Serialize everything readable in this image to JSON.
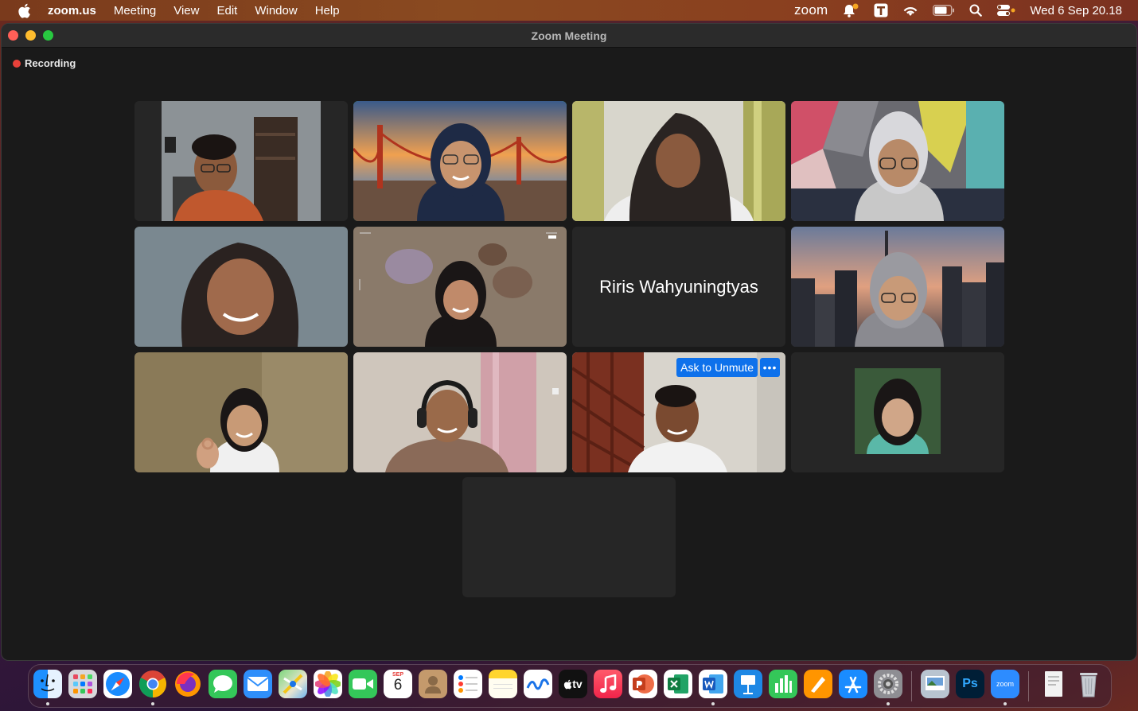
{
  "menubar": {
    "app_name": "zoom.us",
    "menus": [
      "Meeting",
      "View",
      "Edit",
      "Window",
      "Help"
    ],
    "status": {
      "zoom_label": "zoom",
      "clock": "Wed 6 Sep  20.18"
    }
  },
  "window": {
    "title": "Zoom Meeting",
    "recording_label": "Recording"
  },
  "gallery": {
    "name_card": "Riris Wahyuningtyas",
    "ask_unmute_label": "Ask to Unmute",
    "more_label": "•••"
  },
  "dock": {
    "calendar_month": "SEP",
    "calendar_day": "6",
    "tv_label": "tv",
    "ps_label": "Ps",
    "zoom_label": "zoom"
  },
  "colors": {
    "active_speaker_border": "#2fd35a",
    "accent_blue": "#0e71eb",
    "recording_red": "#e8413a"
  }
}
